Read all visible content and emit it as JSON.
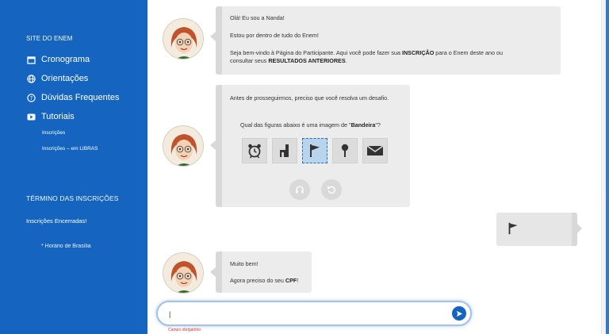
{
  "sidebar": {
    "heading": "SITE DO ENEM",
    "items": [
      {
        "label": "Cronograma",
        "icon": "calendar-icon"
      },
      {
        "label": "Orientações",
        "icon": "globe-icon"
      },
      {
        "label": "Dúvidas Frequentes",
        "icon": "question-icon"
      },
      {
        "label": "Tutoriais",
        "icon": "video-icon"
      }
    ],
    "subitems": [
      "Inscrições",
      "Inscrições – em LIBRAS"
    ],
    "end_heading": "TÉRMINO DAS INSCRIÇÕES",
    "end_status": "Inscrições Encerradas!",
    "timezone_note": "* Horário de Brasília"
  },
  "messages": {
    "greeting": {
      "line1": "Olá! Eu sou a Nanda!",
      "line2": "Estou por dentro de tudo do Enem!",
      "line3_pre": "Seja bem-vindo à Página do Participante. Aqui você pode fazer sua ",
      "line3_bold1": "INSCRIÇÃO",
      "line3_mid": " para o Enem deste ano ou",
      "line4_pre": "consultar seus ",
      "line4_bold": "RESULTADOS ANTERIORES",
      "line4_end": "."
    },
    "challenge": {
      "intro": "Antes de prosseguirmos, preciso que você resolva um desafio.",
      "question_pre": "Qual das figuras abaixo é uma imagem de \"",
      "question_bold": "Bandeira",
      "question_end": "\"?",
      "figures": [
        "alarm-clock-icon",
        "chair-icon",
        "flag-icon",
        "pin-icon",
        "envelope-icon"
      ],
      "selected_index": 2,
      "audio_icon": "headphones-icon",
      "refresh_icon": "refresh-icon"
    },
    "user_reply_icon": "flag-icon",
    "response": {
      "line1": "Muito bem!",
      "line2_pre": "Agora preciso do seu ",
      "line2_bold": "CPF",
      "line2_end": "!"
    }
  },
  "input": {
    "value": "|",
    "required_note": "Campo obrigatório",
    "send_icon": "send-icon"
  },
  "colors": {
    "brand": "#1565c0",
    "bubble": "#ececec",
    "selected": "#b9d5ee"
  }
}
